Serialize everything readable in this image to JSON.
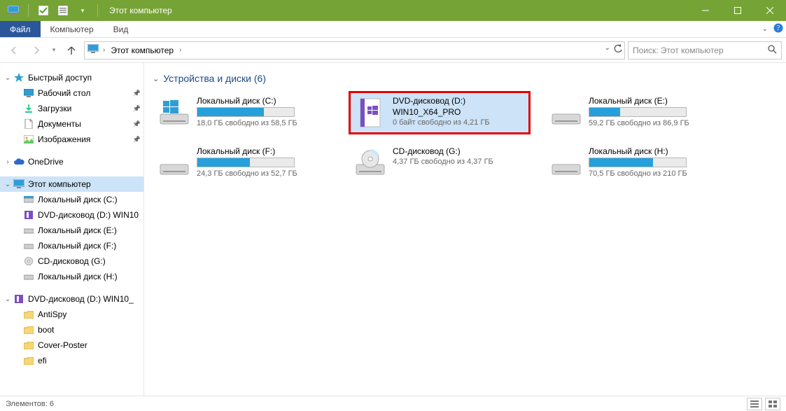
{
  "titlebar": {
    "title": "Этот компьютер"
  },
  "ribbon": {
    "file": "Файл",
    "tabs": [
      "Компьютер",
      "Вид"
    ]
  },
  "breadcrumb": {
    "root": "Этот компьютер"
  },
  "search": {
    "placeholder": "Поиск: Этот компьютер"
  },
  "sidebar": {
    "quick_access": {
      "label": "Быстрый доступ",
      "items": [
        {
          "label": "Рабочий стол"
        },
        {
          "label": "Загрузки"
        },
        {
          "label": "Документы"
        },
        {
          "label": "Изображения"
        }
      ]
    },
    "onedrive": {
      "label": "OneDrive"
    },
    "this_pc": {
      "label": "Этот компьютер",
      "items": [
        {
          "label": "Локальный диск (C:)"
        },
        {
          "label": "DVD-дисковод (D:) WIN10"
        },
        {
          "label": "Локальный диск (E:)"
        },
        {
          "label": "Локальный диск (F:)"
        },
        {
          "label": "CD-дисковод (G:)"
        },
        {
          "label": "Локальный диск (H:)"
        }
      ]
    },
    "dvd": {
      "label": "DVD-дисковод (D:) WIN10_",
      "items": [
        {
          "label": "AntiSpy"
        },
        {
          "label": "boot"
        },
        {
          "label": "Cover-Poster"
        },
        {
          "label": "efi"
        }
      ]
    }
  },
  "content": {
    "group_title": "Устройства и диски (6)",
    "drives": [
      {
        "name": "Локальный диск (C:)",
        "free": "18,0 ГБ свободно из 58,5 ГБ",
        "fill": 69,
        "type": "win",
        "highlight": false
      },
      {
        "name": "DVD-дисковод (D:)",
        "name2": "WIN10_X64_PRO",
        "free": "0 байт свободно из 4,21 ГБ",
        "fill": 0,
        "type": "dvd-win",
        "highlight": true,
        "nobar": true
      },
      {
        "name": "Локальный диск (E:)",
        "free": "59,2 ГБ свободно из 86,9 ГБ",
        "fill": 32,
        "type": "hdd",
        "highlight": false
      },
      {
        "name": "Локальный диск (F:)",
        "free": "24,3 ГБ свободно из 52,7 ГБ",
        "fill": 54,
        "type": "hdd",
        "highlight": false
      },
      {
        "name": "CD-дисковод (G:)",
        "free": "4,37 ГБ свободно из 4,37 ГБ",
        "fill": 0,
        "type": "cd",
        "highlight": false,
        "nobar": true
      },
      {
        "name": "Локальный диск (H:)",
        "free": "70,5 ГБ свободно из 210 ГБ",
        "fill": 66,
        "type": "hdd",
        "highlight": false
      }
    ]
  },
  "statusbar": {
    "text": "Элементов: 6"
  },
  "colors": {
    "accent": "#76a335",
    "filetab": "#2b579a",
    "bar_fill": "#26a0da",
    "select": "#cde3f8",
    "highlight_border": "#e10000"
  }
}
